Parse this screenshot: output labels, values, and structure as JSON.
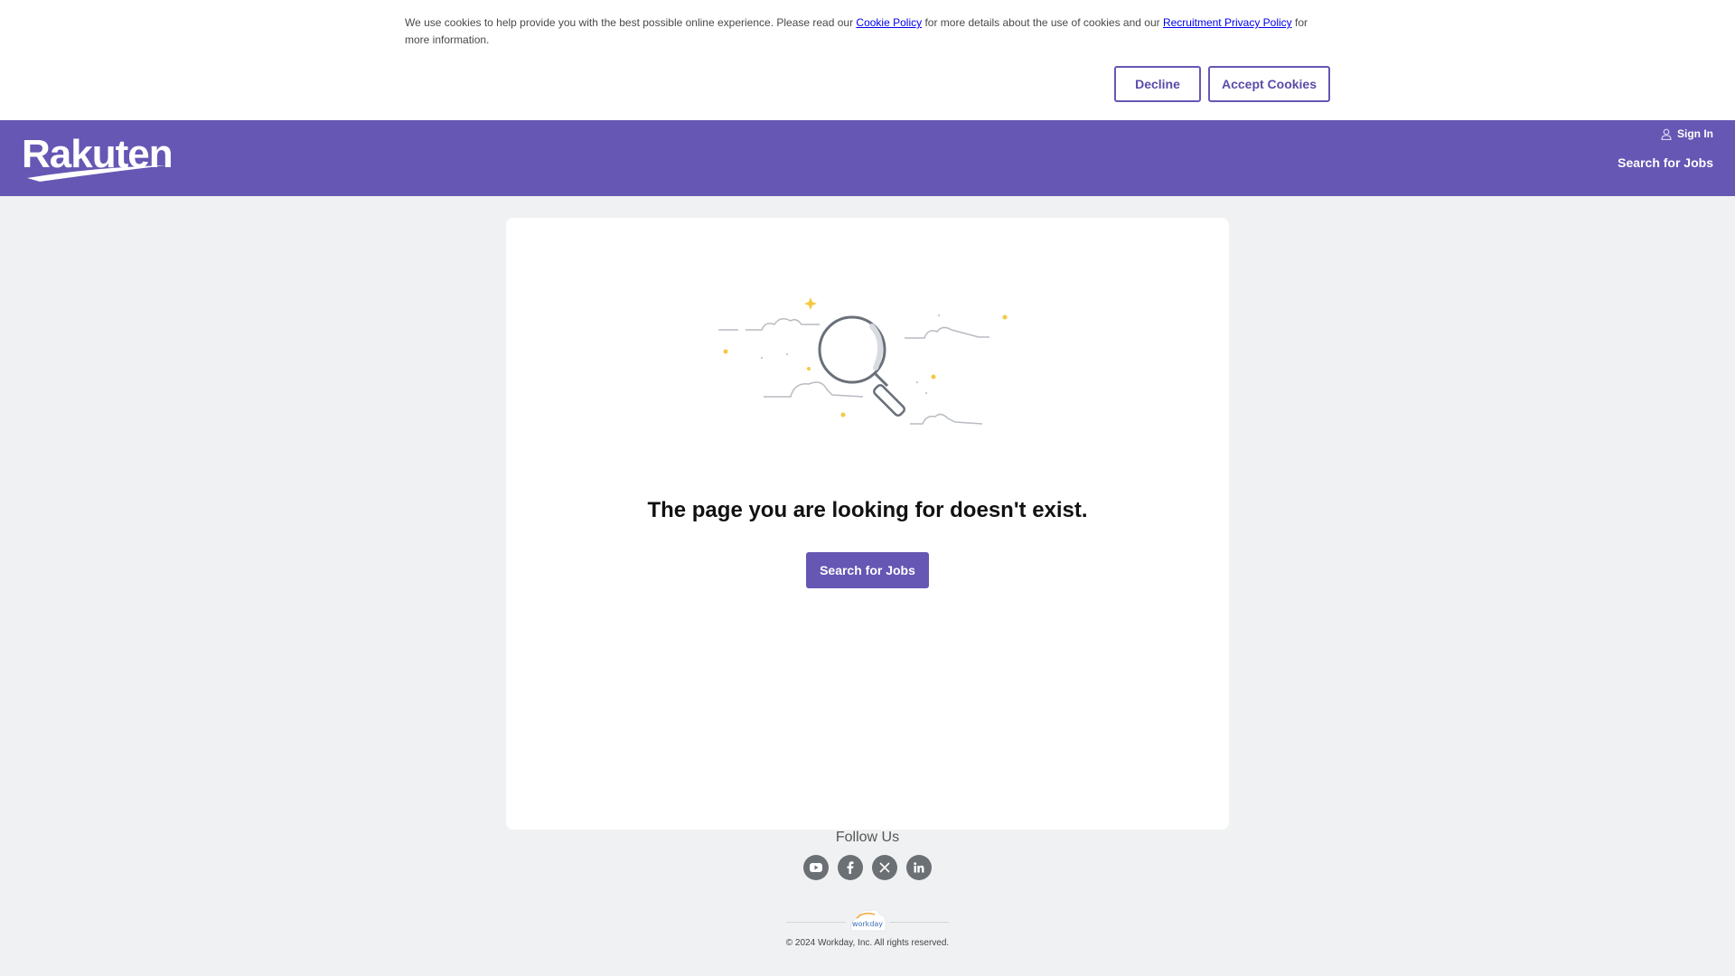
{
  "cookie_banner": {
    "text_before": "We use cookies to help provide you with the best possible online experience. Please read our ",
    "cookie_policy_link": "Cookie Policy",
    "text_middle": " for more details about the use of cookies and our ",
    "privacy_policy_link": "Recruitment Privacy Policy",
    "text_after": " for more information.",
    "decline_label": "Decline",
    "accept_label": "Accept Cookies"
  },
  "header": {
    "logo_text": "Rakuten",
    "sign_in_label": "Sign In",
    "search_jobs_label": "Search for Jobs",
    "background_color": "#6657b4"
  },
  "main": {
    "illustration_icon": "magnifying-glass-icon",
    "message": "The page you are looking for doesn't exist.",
    "search_jobs_button": "Search for Jobs"
  },
  "footer": {
    "follow_label": "Follow Us",
    "socials": [
      {
        "name": "youtube-icon"
      },
      {
        "name": "facebook-icon"
      },
      {
        "name": "x-icon"
      },
      {
        "name": "linkedin-icon"
      }
    ],
    "workday_logo": "workday",
    "copyright": "© 2024 Workday, Inc. All rights reserved."
  }
}
